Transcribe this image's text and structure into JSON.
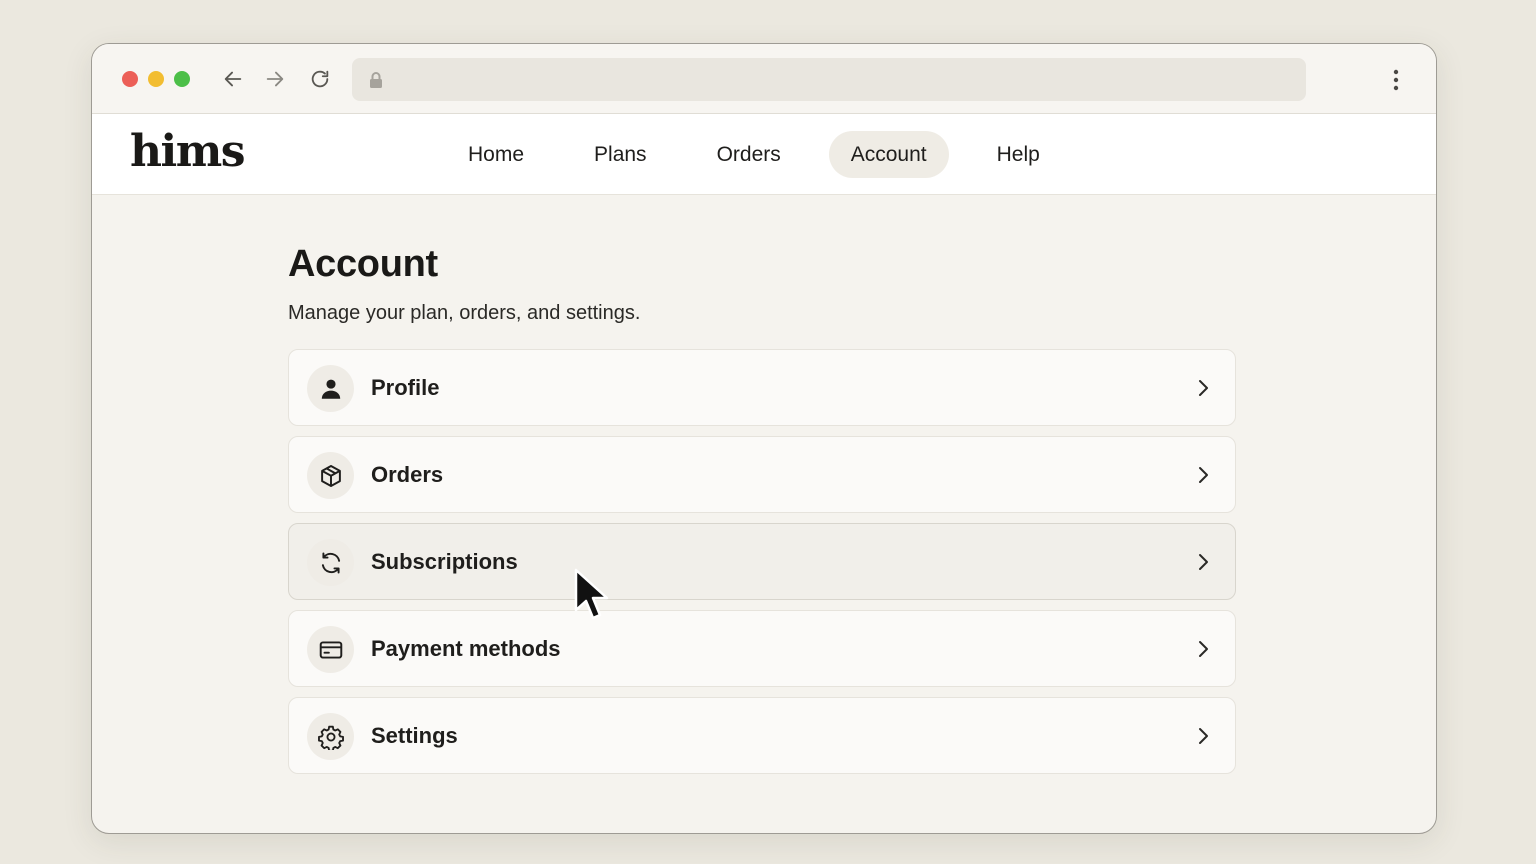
{
  "browser": {
    "window_controls": [
      "close",
      "minimize",
      "maximize"
    ],
    "nav_icons": [
      "back-arrow-icon",
      "forward-arrow-icon",
      "reload-icon"
    ],
    "address_icon": "lock-icon",
    "menu_icon": "more-vertical-icon"
  },
  "site": {
    "logo": "hims",
    "nav": [
      {
        "label": "Home",
        "active": false
      },
      {
        "label": "Plans",
        "active": false
      },
      {
        "label": "Orders",
        "active": false
      },
      {
        "label": "Account",
        "active": true
      },
      {
        "label": "Help",
        "active": false
      }
    ]
  },
  "page": {
    "title": "Account",
    "subtitle": "Manage your plan, orders, and settings.",
    "items": [
      {
        "label": "Profile",
        "icon": "person-icon"
      },
      {
        "label": "Orders",
        "icon": "box-icon"
      },
      {
        "label": "Subscriptions",
        "icon": "refresh-icon",
        "hovered": true
      },
      {
        "label": "Payment methods",
        "icon": "credit-card-icon"
      },
      {
        "label": "Settings",
        "icon": "gear-icon"
      }
    ]
  },
  "colors": {
    "background": "#ebe8df",
    "page": "#f5f3ee",
    "nav_active": "#efece5",
    "text": "#1c1b19"
  }
}
